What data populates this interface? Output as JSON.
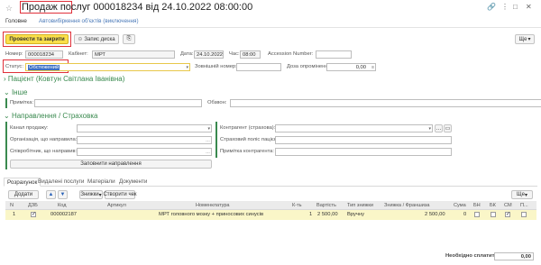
{
  "window": {
    "title": "Продаж послуг 000018234 від 24.10.2022 08:00:00",
    "title_part1": "Продаж послуг",
    "title_part2": " 000018234 від 24.10.2022 08:00:00",
    "icons": [
      "link-icon",
      "more-icon",
      "maximize-icon",
      "close-icon"
    ]
  },
  "tabs": [
    {
      "label": "Головне",
      "active": true
    },
    {
      "label": "Автовибіркення об'єктів (виключення)",
      "active": false
    }
  ],
  "toolbar": {
    "post_close_label": "Провести та закрити",
    "save_label": "Запис диска",
    "more_label": "Ще"
  },
  "header": {
    "number_label": "Номер:",
    "number_value": "000018234",
    "cabinet_label": "Кабінет:",
    "cabinet_value": "МРТ",
    "date_label": "Дата:",
    "date_value": "24.10.2022",
    "time_label": "Час:",
    "time_value": "08:00",
    "accession_label": "Accession Number:",
    "accession_value": "",
    "status_label": "Статус:",
    "status_value": "Обстежений",
    "external_number_label": "Зовнішній номер:",
    "external_number_value": "",
    "payment_label": "Доза опромінення:",
    "payment_value": "0,00"
  },
  "patient": {
    "section_label": "Пацієнт (Ковтун Світлана Іванівна)"
  },
  "other": {
    "section_label": "Інше",
    "note_label": "Примітка:",
    "note_value": "",
    "review_label": "Обзвон:",
    "review_value": ""
  },
  "referral": {
    "section_label": "Направлення / Страховка",
    "sales_channel_label": "Канал продажу:",
    "org_label": "Організація, що направила:",
    "employee_label": "Співробітник, що направив:",
    "fill_button_label": "Заповнити направлення",
    "counterparty_label": "Контрагент (страхова):",
    "policy_label": "Страховий поліс пацієнта:",
    "counterparty_note_label": "Примітка контрагента:"
  },
  "bottom_tabs": [
    {
      "label": "Розрахунок",
      "active": true
    },
    {
      "label": "Видалені послуги",
      "active": false
    },
    {
      "label": "Матеріали",
      "active": false
    },
    {
      "label": "Документи",
      "active": false
    }
  ],
  "table_toolbar": {
    "add_label": "Додати",
    "discounts_label": "Знижки",
    "create_check_label": "Створити чек",
    "more_label": "Ще"
  },
  "table": {
    "columns": [
      "N",
      "ДЗБ",
      "Код",
      "Артикул",
      "Номенклатура",
      "К-ть",
      "Вартість",
      "Тип знижки",
      "Знижка / Франшиза",
      "Сума",
      "БН",
      "БК",
      "СМ",
      "П..."
    ],
    "rows": [
      {
        "n": "1",
        "dzb": true,
        "code": "000002187",
        "article": "",
        "nomenclature": "МРТ головного мозку + приносових синусів",
        "qty": "1",
        "price": "2 500,00",
        "discount_type": "Вручну",
        "discount": "2 500,00",
        "sum": "0",
        "bn": false,
        "bk": false,
        "sm": true,
        "p": false
      }
    ]
  },
  "footer": {
    "need_pay_label": "Необхідно сплатити:",
    "need_pay_value": "0,00"
  },
  "colors": {
    "accent_yellow": "#fbe04b",
    "highlight_red": "#e0303a",
    "section_green": "#3a8a4f",
    "link_blue": "#4a79b8"
  }
}
